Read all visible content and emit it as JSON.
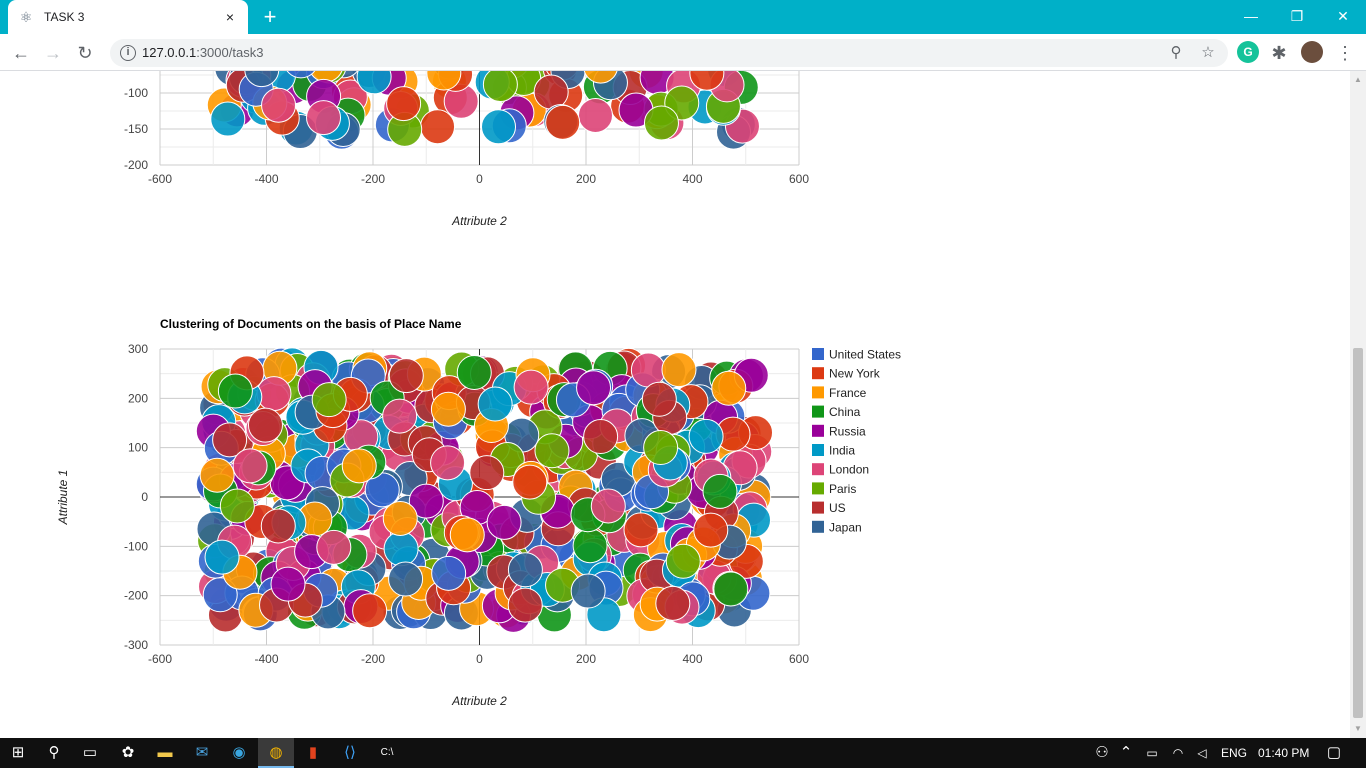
{
  "browser": {
    "tab_title": "TASK 3",
    "tab_close": "×",
    "new_tab": "+",
    "url_host": "127.0.0.1",
    "url_rest": ":3000/task3",
    "min": "—",
    "restore": "❐",
    "close": "✕",
    "profile_initial": "G"
  },
  "chart_top": {
    "y_ticks": [
      "-100",
      "-150",
      "-200"
    ],
    "x_ticks": [
      "-600",
      "-400",
      "-200",
      "0",
      "200",
      "400",
      "600"
    ],
    "xlabel": "Attribute 2"
  },
  "chart_data": [
    {
      "type": "scatter",
      "title": "",
      "xlabel": "Attribute 2",
      "ylabel": "",
      "xlim": [
        -600,
        600
      ],
      "ylim": [
        -200,
        -50
      ],
      "grid": true,
      "note": "partially scrolled out of view; bubbles spread x≈-480..520, y≈-60..-160"
    },
    {
      "type": "scatter",
      "title": "Clustering of Documents on the basis of Place Name",
      "xlabel": "Attribute 2",
      "ylabel": "Attribute 1",
      "xlim": [
        -600,
        600
      ],
      "ylim": [
        -300,
        300
      ],
      "grid": true,
      "legend_position": "right",
      "series": [
        {
          "name": "United States",
          "color": "#3366cc"
        },
        {
          "name": "New York",
          "color": "#dc3912"
        },
        {
          "name": "France",
          "color": "#ff9900"
        },
        {
          "name": "China",
          "color": "#109618"
        },
        {
          "name": "Russia",
          "color": "#990099"
        },
        {
          "name": "India",
          "color": "#0099c6"
        },
        {
          "name": "London",
          "color": "#dd4477"
        },
        {
          "name": "Paris",
          "color": "#66aa00"
        },
        {
          "name": "US",
          "color": "#b82e2e"
        },
        {
          "name": "Japan",
          "color": "#316395"
        }
      ],
      "x_ticks": [
        "-600",
        "-400",
        "-200",
        "0",
        "200",
        "400",
        "600"
      ],
      "y_ticks": [
        "300",
        "200",
        "100",
        "0",
        "-100",
        "-200",
        "-300"
      ],
      "point_ranges": [
        {
          "x": [
            -500,
            -60
          ],
          "y": [
            -240,
            270
          ]
        },
        {
          "x": [
            -60,
            280
          ],
          "y": [
            -240,
            270
          ]
        },
        {
          "x": [
            300,
            520
          ],
          "y": [
            -240,
            260
          ]
        }
      ]
    }
  ],
  "taskbar": {
    "lang": "ENG",
    "time": "01:40 PM"
  }
}
